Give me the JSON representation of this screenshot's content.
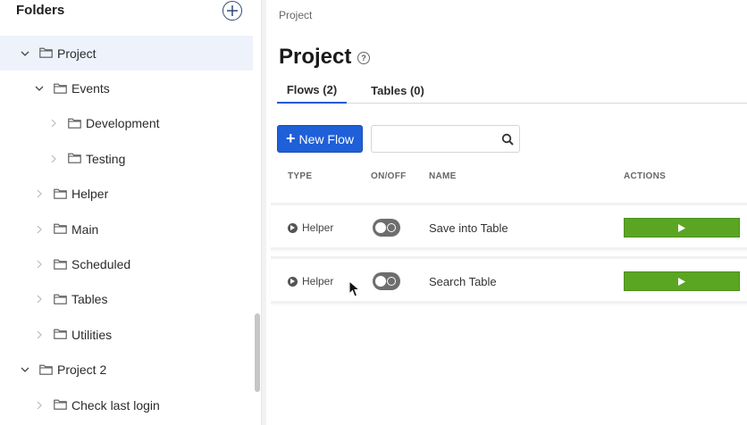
{
  "sidebar": {
    "title": "Folders",
    "tree": [
      {
        "label": "Project",
        "level": 0,
        "expanded": true,
        "selected": true
      },
      {
        "label": "Events",
        "level": 1,
        "expanded": true,
        "selected": false
      },
      {
        "label": "Development",
        "level": 2,
        "expanded": false,
        "selected": false
      },
      {
        "label": "Testing",
        "level": 2,
        "expanded": false,
        "selected": false
      },
      {
        "label": "Helper",
        "level": 1,
        "expanded": false,
        "selected": false
      },
      {
        "label": "Main",
        "level": 1,
        "expanded": false,
        "selected": false
      },
      {
        "label": "Scheduled",
        "level": 1,
        "expanded": false,
        "selected": false
      },
      {
        "label": "Tables",
        "level": 1,
        "expanded": false,
        "selected": false
      },
      {
        "label": "Utilities",
        "level": 1,
        "expanded": false,
        "selected": false
      },
      {
        "label": "Project 2",
        "level": 0,
        "expanded": true,
        "selected": false
      },
      {
        "label": "Check last login",
        "level": 1,
        "expanded": false,
        "selected": false
      }
    ]
  },
  "main": {
    "breadcrumb": "Project",
    "title": "Project",
    "help_icon": "?",
    "tabs": [
      {
        "label": "Flows (2)",
        "active": true
      },
      {
        "label": "Tables (0)",
        "active": false
      }
    ],
    "new_flow_label": "New Flow",
    "search_placeholder": "",
    "columns": {
      "type": "TYPE",
      "onoff": "ON/OFF",
      "name": "NAME",
      "actions": "ACTIONS"
    },
    "flows": [
      {
        "type": "Helper",
        "enabled": false,
        "name": "Save into Table"
      },
      {
        "type": "Helper",
        "enabled": false,
        "name": "Search Table"
      }
    ]
  },
  "colors": {
    "accent": "#1f5fd8",
    "run": "#5aa623",
    "selected_row": "#eef2fb"
  }
}
